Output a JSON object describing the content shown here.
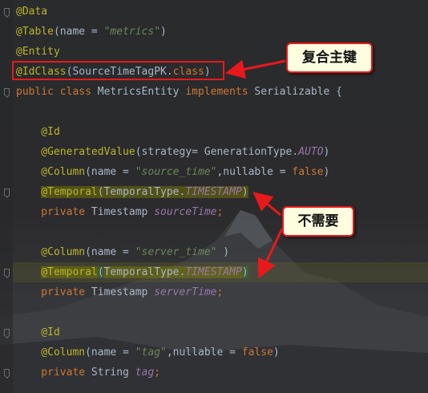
{
  "editor": {
    "lines": [
      {
        "segments": [
          {
            "t": "@Data",
            "c": "ann"
          }
        ]
      },
      {
        "segments": [
          {
            "t": "@Table",
            "c": "ann"
          },
          {
            "t": "(name = ",
            "c": "cls"
          },
          {
            "t": "\"metrics\"",
            "c": "str"
          },
          {
            "t": ")",
            "c": "cls"
          }
        ]
      },
      {
        "segments": [
          {
            "t": "@Entity",
            "c": "ann"
          }
        ]
      },
      {
        "segments": [
          {
            "t": "@IdClass",
            "c": "ann"
          },
          {
            "t": "(SourceTimeTagPK.",
            "c": "cls"
          },
          {
            "t": "class",
            "c": "kw"
          },
          {
            "t": ")",
            "c": "cls"
          }
        ]
      },
      {
        "segments": [
          {
            "t": "public class ",
            "c": "kw"
          },
          {
            "t": "MetricsEntity ",
            "c": "cls"
          },
          {
            "t": "implements ",
            "c": "kw"
          },
          {
            "t": "Serializable {",
            "c": "cls"
          }
        ]
      },
      {
        "segments": []
      },
      {
        "segments": [
          {
            "t": "    @Id",
            "c": "ann"
          }
        ]
      },
      {
        "segments": [
          {
            "t": "    @GeneratedValue",
            "c": "ann"
          },
          {
            "t": "(strategy= GenerationType.",
            "c": "cls"
          },
          {
            "t": "AUTO",
            "c": "const"
          },
          {
            "t": ")",
            "c": "cls"
          }
        ]
      },
      {
        "segments": [
          {
            "t": "    @Column",
            "c": "ann"
          },
          {
            "t": "(name = ",
            "c": "cls"
          },
          {
            "t": "\"source_time\"",
            "c": "str"
          },
          {
            "t": ",nullable = ",
            "c": "cls"
          },
          {
            "t": "false",
            "c": "kw"
          },
          {
            "t": ")",
            "c": "cls"
          }
        ]
      },
      {
        "segments": [
          {
            "t": "    ",
            "c": "cls"
          },
          {
            "t": "@Temporal",
            "c": "ann warn-bg"
          },
          {
            "t": "(TemporalType.",
            "c": "cls warn-bg"
          },
          {
            "t": "TIMESTAMP",
            "c": "const warn-bg"
          },
          {
            "t": ")",
            "c": "cls warn-bg"
          }
        ]
      },
      {
        "segments": [
          {
            "t": "    private ",
            "c": "kw"
          },
          {
            "t": "Timestamp ",
            "c": "cls"
          },
          {
            "t": "sourceTime",
            "c": "const"
          },
          {
            "t": ";",
            "c": "kw"
          }
        ]
      },
      {
        "segments": []
      },
      {
        "segments": [
          {
            "t": "    @Column",
            "c": "ann"
          },
          {
            "t": "(name = ",
            "c": "cls"
          },
          {
            "t": "\"server_time\"",
            "c": "str"
          },
          {
            "t": " )",
            "c": "cls"
          }
        ]
      },
      {
        "segments": [
          {
            "t": "    ",
            "c": "cls"
          },
          {
            "t": "@Temporal",
            "c": "ann warn-bg"
          },
          {
            "t": "(",
            "c": "cls paren-match"
          },
          {
            "t": "TemporalType.",
            "c": "cls warn-bg"
          },
          {
            "t": "TIMESTAMP",
            "c": "const warn-bg"
          },
          {
            "t": ")",
            "c": "cls paren-match"
          }
        ]
      },
      {
        "segments": [
          {
            "t": "    private ",
            "c": "kw"
          },
          {
            "t": "Timestamp ",
            "c": "cls"
          },
          {
            "t": "serverTime",
            "c": "const"
          },
          {
            "t": ";",
            "c": "kw"
          }
        ]
      },
      {
        "segments": []
      },
      {
        "segments": [
          {
            "t": "    @Id",
            "c": "ann"
          }
        ]
      },
      {
        "segments": [
          {
            "t": "    @Column",
            "c": "ann"
          },
          {
            "t": "(name = ",
            "c": "cls"
          },
          {
            "t": "\"tag\"",
            "c": "str"
          },
          {
            "t": ",nullable = ",
            "c": "cls"
          },
          {
            "t": "false",
            "c": "kw"
          },
          {
            "t": ")",
            "c": "cls"
          }
        ]
      },
      {
        "segments": [
          {
            "t": "    private ",
            "c": "kw"
          },
          {
            "t": "String ",
            "c": "cls"
          },
          {
            "t": "tag",
            "c": "const"
          },
          {
            "t": ";",
            "c": "kw"
          }
        ]
      }
    ]
  },
  "annotations": {
    "composite_key_label": "复合主键",
    "not_needed_label": "不需要"
  },
  "colors": {
    "annotation": "#bbb529",
    "keyword": "#cc7832",
    "string": "#6a8759",
    "constant": "#9876aa",
    "highlight_red": "#e8191c",
    "callout_bg": "#fffde0"
  }
}
